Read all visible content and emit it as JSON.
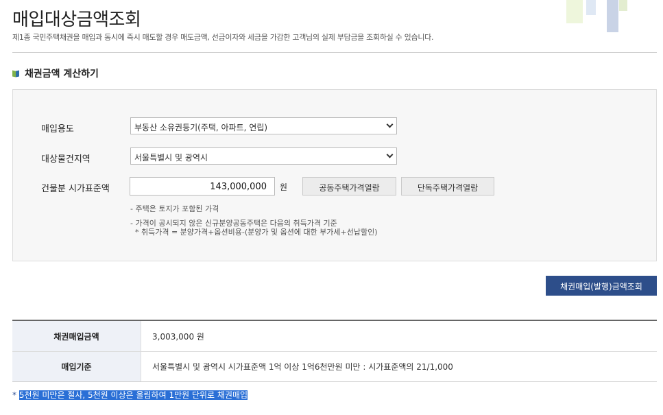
{
  "page": {
    "title": "매입대상금액조회",
    "description": "제1종 국민주택채권을 매입과 동시에 즉시 매도할 경우 매도금액, 선급이자와 세금을 가감한 고객님의 실제 부담금을 조회하실 수 있습니다."
  },
  "top_util": [
    "",
    "",
    ""
  ],
  "section": {
    "title": "채권금액 계산하기"
  },
  "form": {
    "purpose": {
      "label": "매입용도",
      "value": "부동산 소유권등기(주택, 아파트, 연립)"
    },
    "region": {
      "label": "대상물건지역",
      "value": "서울특별시 및 광역시"
    },
    "price": {
      "label": "건물분 시가표준액",
      "value": "143,000,000",
      "unit": "원"
    },
    "btn_apartment": "공동주택가격열람",
    "btn_house": "단독주택가격열람",
    "notes": [
      "- 주택은 토지가 포함된 가격",
      "- 가격이 공시되지 않은 신규분양공동주택은 다음의 취득가격 기준",
      "  * 취득가격 = 분양가격+옵션비용-(분양가 및 옵션에 대한 부가세+선납할인)"
    ]
  },
  "submit_label": "채권매입(발행)금액조회",
  "result": {
    "rows": [
      {
        "label": "채권매입금액",
        "value": "3,003,000 원"
      },
      {
        "label": "매입기준",
        "value": "서울특별시 및 광역시 시가표준액 1억 이상 1억6천만원 미만 : 시가표준액의 21/1,000"
      }
    ]
  },
  "footnote": {
    "prefix": "* ",
    "text": "5천원 미만은 절사, 5천원 이상은 올림하여 1만원 단위로 채권매입"
  }
}
